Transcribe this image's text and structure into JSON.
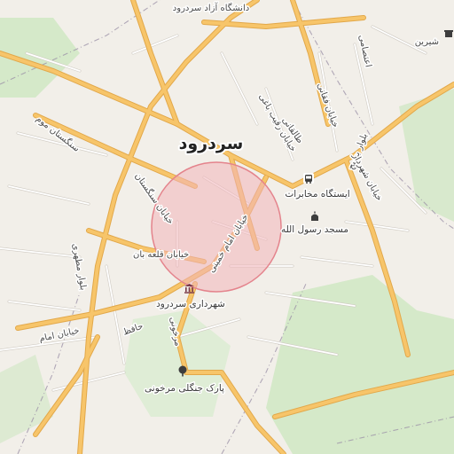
{
  "map": {
    "colors": {
      "background": "#f2efe9",
      "green": "#cde7c0",
      "road": "#f7c56a",
      "road_casing": "#e2a84a",
      "minor_road": "#ffffff",
      "minor_road_casing": "#cfcac2",
      "boundary": "#9a8fa6",
      "highlight_fill": "#f2b4b9",
      "highlight_stroke": "#e4838c"
    },
    "city_label": "سردرود",
    "streets": {
      "university": "دانشگاه آزاد سردرود",
      "shirin": "شیرین",
      "etesami": "اعتصامی",
      "faqani": "خیابان فقانی",
      "raqib": "خیابان رقیب باغی",
      "taleghani": "طالقانی",
      "basij": "بلوار بسیج",
      "shahrdar": "خیابان شهردار",
      "sangestan_mo": "سنگستان موم",
      "sangestan": "خیابان سنگستان",
      "khomeini": "خیابان امام خمینی",
      "qalebon": "خیابان قلعه بان",
      "motahari": "بلوار مطهری",
      "imam": "خیابان امام",
      "hafez": "حافظ",
      "markhuni": "مرخونی"
    },
    "pois": {
      "bus_stop": "ایستگاه مخابرات",
      "mosque": "مسجد رسول الله",
      "municipality": "شهرداری سردرود",
      "park": "پارک جنگلی مرخونی"
    },
    "icons": {
      "bus": "bus-icon",
      "mosque": "mosque-icon",
      "municipality": "building-icon",
      "park": "tree-icon",
      "shop": "shop-icon"
    }
  }
}
